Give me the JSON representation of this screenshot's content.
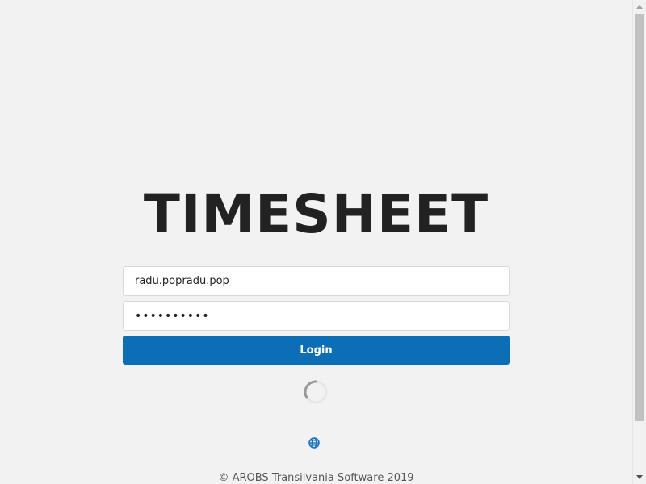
{
  "app": {
    "title": "TIMESHEET"
  },
  "login": {
    "username_value": "radu.popradu.pop",
    "password_value": "1234567890",
    "button_label": "Login"
  },
  "status": {
    "loading": true
  },
  "footer": {
    "copyright": "© AROBS Transilvania Software 2019"
  },
  "icons": {
    "language": "globe-icon",
    "loading": "spinner-icon"
  },
  "colors": {
    "accent": "#0d6eb8",
    "background": "#f2f2f2",
    "title": "#222222"
  }
}
